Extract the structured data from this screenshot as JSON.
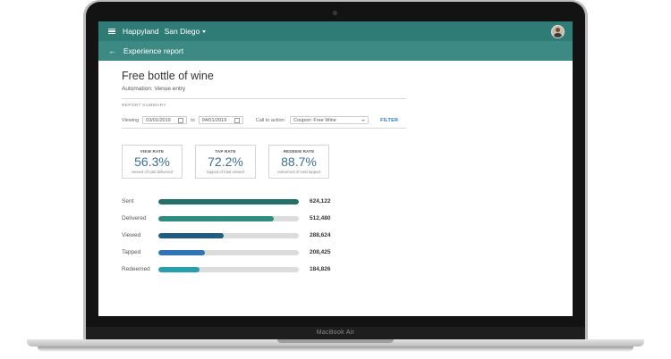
{
  "app": {
    "brand": "Happyland",
    "location": "San Diego",
    "page_title": "Experience report"
  },
  "report": {
    "title": "Free bottle of wine",
    "automation": "Automation: Venue entry",
    "section_label": "REPORT SUMMARY"
  },
  "filters": {
    "viewing_label": "Viewing",
    "start_date": "03/01/2019",
    "to_label": "to",
    "end_date": "04/01/2019",
    "cta_label": "Call to action:",
    "cta_value": "Coupon: Free Wine",
    "filter_button": "FILTER"
  },
  "stats": [
    {
      "label": "VIEW RATE",
      "value": "56.3%",
      "sub": "viewed of total delivered"
    },
    {
      "label": "TAP RATE",
      "value": "72.2%",
      "sub": "tapped of total viewed"
    },
    {
      "label": "REDEEM RATE",
      "value": "88.7%",
      "sub": "redeemed of total tapped"
    }
  ],
  "funnel": [
    {
      "label": "Sent",
      "value_text": "624,122",
      "value": 624122,
      "color": "#23706b"
    },
    {
      "label": "Delivered",
      "value_text": "512,480",
      "value": 512480,
      "color": "#2f8a80"
    },
    {
      "label": "Viewed",
      "value_text": "288,624",
      "value": 288624,
      "color": "#1f5b82"
    },
    {
      "label": "Tapped",
      "value_text": "208,425",
      "value": 208425,
      "color": "#2f74b4"
    },
    {
      "label": "Redeemed",
      "value_text": "184,826",
      "value": 184826,
      "color": "#27a0ae"
    }
  ],
  "device": {
    "model": "MacBook Air"
  }
}
